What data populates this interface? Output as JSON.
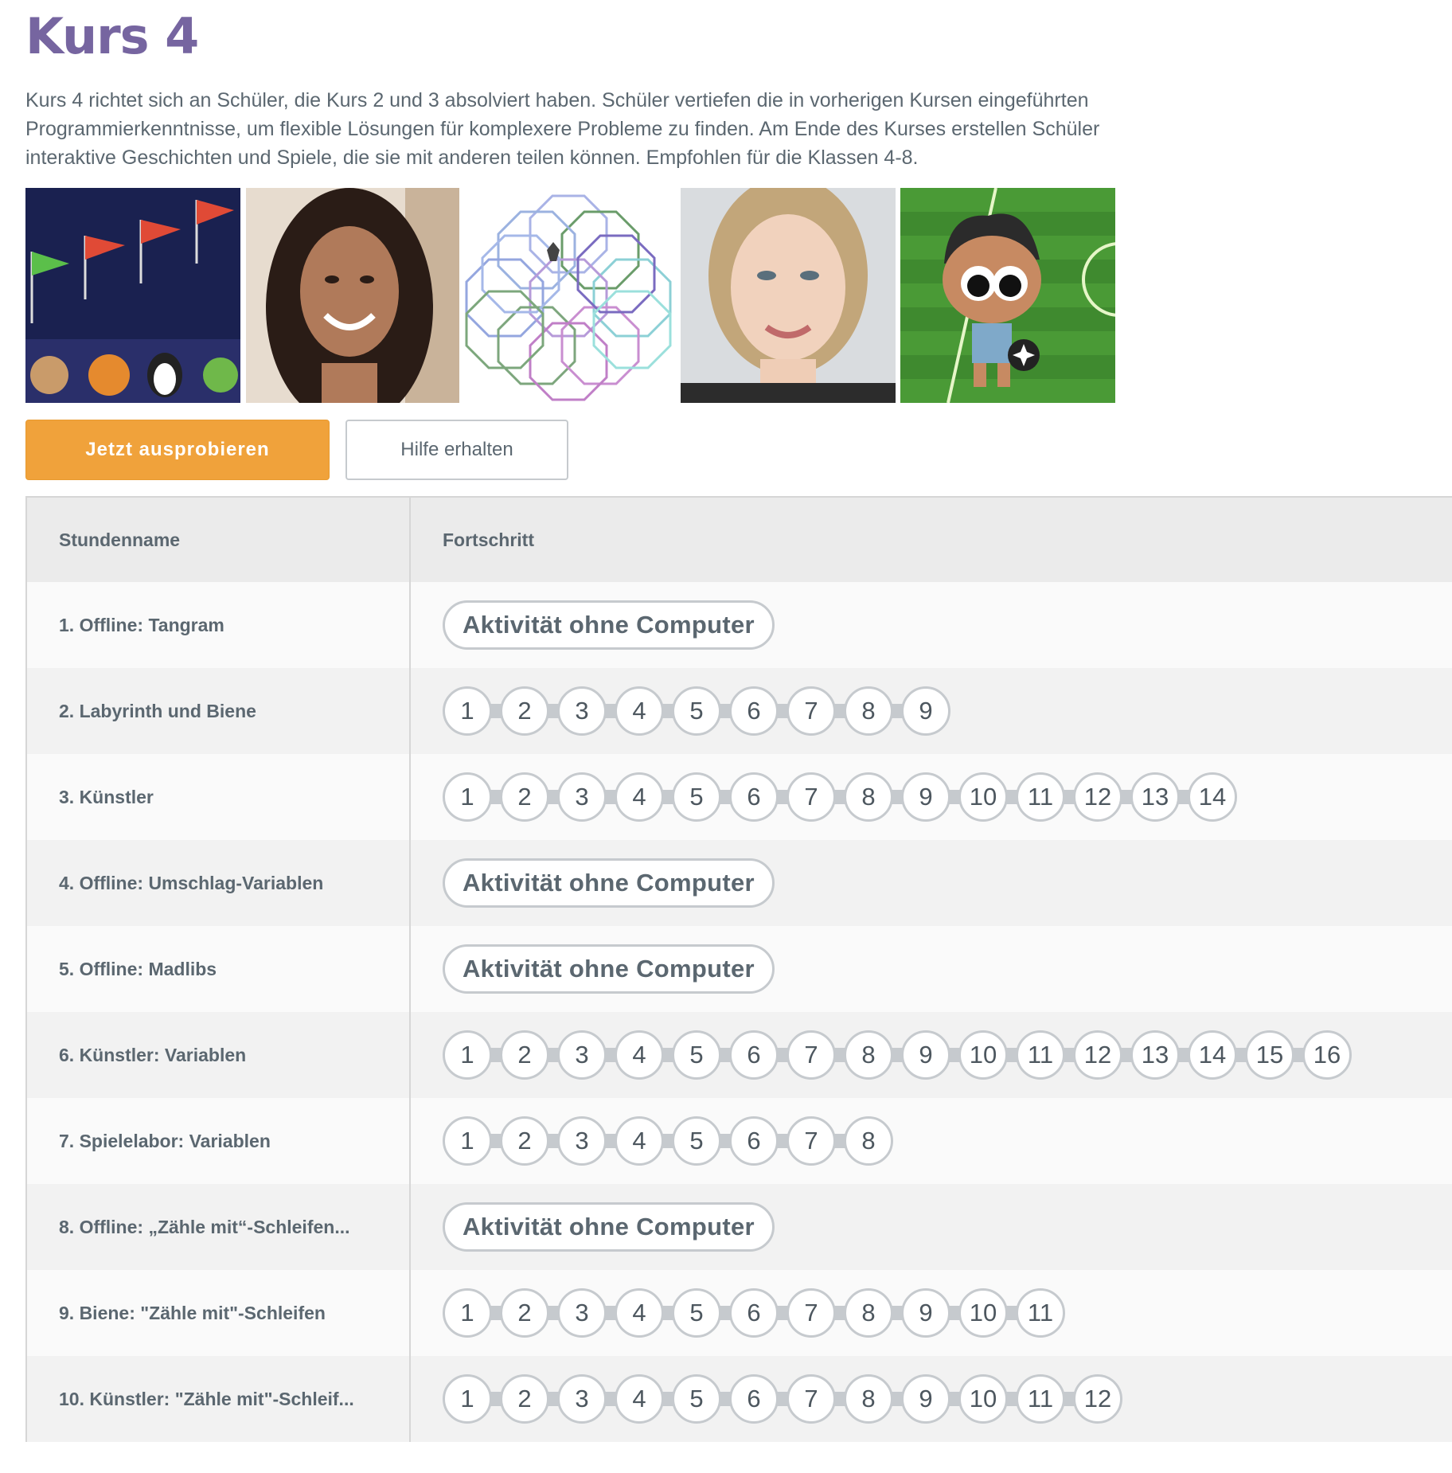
{
  "course": {
    "title": "Kurs 4",
    "description": "Kurs 4 richtet sich an Schüler, die Kurs 2 und 3 absolviert haben. Schüler vertiefen die in vorherigen Kursen eingeführten Programmierkenntnisse, um flexible Lösungen für komplexere Probleme zu finden. Am Ende des Kurses erstellen Schüler interaktive Geschichten und Spiele, die sie mit anderen teilen können. Empfohlen für die Klassen 4-8."
  },
  "images": [
    "flags-and-characters",
    "smiling-woman-portrait",
    "octagon-pattern-art",
    "blonde-woman-portrait",
    "cartoon-boy-soccer"
  ],
  "buttons": {
    "try_now": "Jetzt ausprobieren",
    "get_help": "Hilfe erhalten"
  },
  "table": {
    "headers": {
      "name": "Stundenname",
      "progress": "Fortschritt"
    },
    "offline_label": "Aktivität ohne Computer",
    "rows": [
      {
        "name": "1. Offline: Tangram",
        "offline": true,
        "levels": 0
      },
      {
        "name": "2. Labyrinth und Biene",
        "offline": false,
        "levels": 9
      },
      {
        "name": "3. Künstler",
        "offline": false,
        "levels": 14
      },
      {
        "name": "4. Offline: Umschlag-Variablen",
        "offline": true,
        "levels": 0
      },
      {
        "name": "5. Offline: Madlibs",
        "offline": true,
        "levels": 0
      },
      {
        "name": "6. Künstler: Variablen",
        "offline": false,
        "levels": 16
      },
      {
        "name": "7. Spielelabor: Variablen",
        "offline": false,
        "levels": 8
      },
      {
        "name": "8. Offline: „Zähle mit“-Schleifen...",
        "offline": true,
        "levels": 0
      },
      {
        "name": "9. Biene: \"Zähle mit\"-Schleifen",
        "offline": false,
        "levels": 11
      },
      {
        "name": "10. Künstler: \"Zähle mit\"-Schleif...",
        "offline": false,
        "levels": 12
      }
    ]
  },
  "colors": {
    "title": "#7665a0",
    "primary_button": "#f0a23b",
    "bubble_border": "#c6cace"
  }
}
